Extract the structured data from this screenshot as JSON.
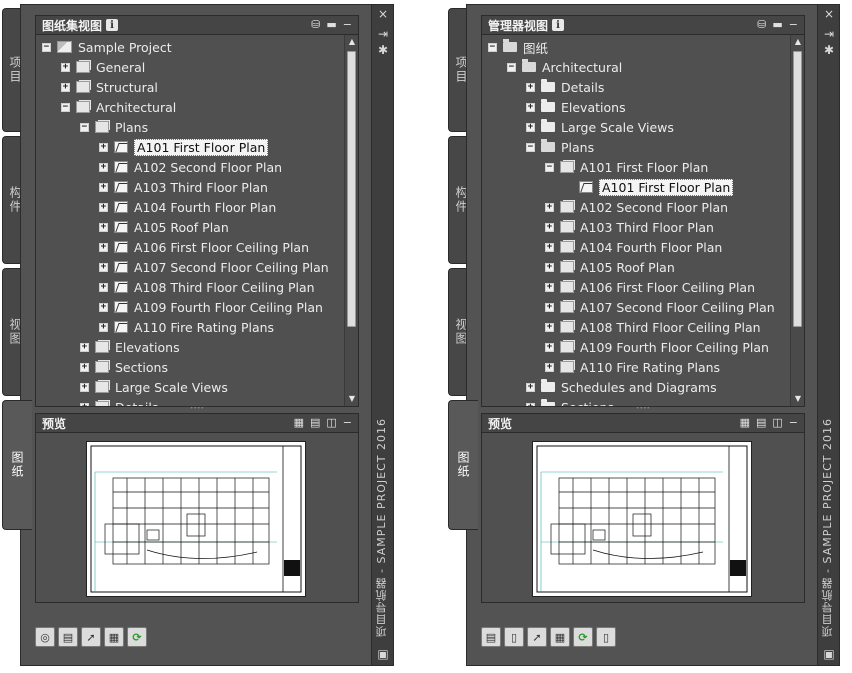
{
  "common": {
    "side_tabs": [
      "项目",
      "构件",
      "视图",
      "图纸"
    ],
    "preview_title": "预览",
    "vertical_title": "项目导航器 - SAMPLE PROJECT 2016",
    "dock_close": "×",
    "dock_pin": "⇥",
    "dock_settings": "✱"
  },
  "left": {
    "title": "图纸集视图",
    "info_glyph": "i",
    "tree": [
      {
        "depth": 0,
        "exp": "−",
        "icon": "proj",
        "label": "Sample Project"
      },
      {
        "depth": 1,
        "exp": "+",
        "icon": "subset",
        "label": "General"
      },
      {
        "depth": 1,
        "exp": "+",
        "icon": "subset",
        "label": "Structural"
      },
      {
        "depth": 1,
        "exp": "−",
        "icon": "subset",
        "label": "Architectural"
      },
      {
        "depth": 2,
        "exp": "−",
        "icon": "subset",
        "label": "Plans"
      },
      {
        "depth": 3,
        "exp": "+",
        "icon": "sheet",
        "label": "A101 First Floor Plan",
        "selected": true
      },
      {
        "depth": 3,
        "exp": "+",
        "icon": "sheet",
        "label": "A102 Second Floor Plan"
      },
      {
        "depth": 3,
        "exp": "+",
        "icon": "sheet",
        "label": "A103 Third Floor Plan"
      },
      {
        "depth": 3,
        "exp": "+",
        "icon": "sheet",
        "label": "A104 Fourth Floor Plan"
      },
      {
        "depth": 3,
        "exp": "+",
        "icon": "sheet",
        "label": "A105 Roof Plan"
      },
      {
        "depth": 3,
        "exp": "+",
        "icon": "sheet",
        "label": "A106 First Floor Ceiling Plan"
      },
      {
        "depth": 3,
        "exp": "+",
        "icon": "sheet",
        "label": "A107 Second Floor Ceiling Plan"
      },
      {
        "depth": 3,
        "exp": "+",
        "icon": "sheet",
        "label": "A108 Third Floor Ceiling Plan"
      },
      {
        "depth": 3,
        "exp": "+",
        "icon": "sheet",
        "label": "A109 Fourth Floor Ceiling Plan"
      },
      {
        "depth": 3,
        "exp": "+",
        "icon": "sheet",
        "label": "A110 Fire Rating Plans"
      },
      {
        "depth": 2,
        "exp": "+",
        "icon": "subset",
        "label": "Elevations"
      },
      {
        "depth": 2,
        "exp": "+",
        "icon": "subset",
        "label": "Sections"
      },
      {
        "depth": 2,
        "exp": "+",
        "icon": "subset",
        "label": "Large Scale Views"
      },
      {
        "depth": 2,
        "exp": "+",
        "icon": "subset",
        "label": "Details"
      }
    ],
    "toolbar": [
      "sheet-set-icon",
      "new-sheet-icon",
      "publish-icon",
      "properties-icon",
      "refresh-icon"
    ]
  },
  "right": {
    "title": "管理器视图",
    "info_glyph": "i",
    "tree": [
      {
        "depth": 0,
        "exp": "−",
        "icon": "folderopen",
        "label": "图纸"
      },
      {
        "depth": 1,
        "exp": "−",
        "icon": "folderopen",
        "label": "Architectural"
      },
      {
        "depth": 2,
        "exp": "+",
        "icon": "folder",
        "label": "Details"
      },
      {
        "depth": 2,
        "exp": "+",
        "icon": "folder",
        "label": "Elevations"
      },
      {
        "depth": 2,
        "exp": "+",
        "icon": "folder",
        "label": "Large Scale Views"
      },
      {
        "depth": 2,
        "exp": "−",
        "icon": "folderopen",
        "label": "Plans"
      },
      {
        "depth": 3,
        "exp": "−",
        "icon": "subset",
        "label": "A101 First Floor Plan"
      },
      {
        "depth": 4,
        "exp": "",
        "icon": "sheet",
        "label": "A101 First Floor Plan",
        "selected": true
      },
      {
        "depth": 3,
        "exp": "+",
        "icon": "subset",
        "label": "A102 Second Floor Plan"
      },
      {
        "depth": 3,
        "exp": "+",
        "icon": "subset",
        "label": "A103 Third Floor Plan"
      },
      {
        "depth": 3,
        "exp": "+",
        "icon": "subset",
        "label": "A104 Fourth Floor Plan"
      },
      {
        "depth": 3,
        "exp": "+",
        "icon": "subset",
        "label": "A105 Roof Plan"
      },
      {
        "depth": 3,
        "exp": "+",
        "icon": "subset",
        "label": "A106 First Floor Ceiling Plan"
      },
      {
        "depth": 3,
        "exp": "+",
        "icon": "subset",
        "label": "A107 Second Floor Ceiling Plan"
      },
      {
        "depth": 3,
        "exp": "+",
        "icon": "subset",
        "label": "A108 Third Floor Ceiling Plan"
      },
      {
        "depth": 3,
        "exp": "+",
        "icon": "subset",
        "label": "A109 Fourth Floor Ceiling Plan"
      },
      {
        "depth": 3,
        "exp": "+",
        "icon": "subset",
        "label": "A110 Fire Rating Plans"
      },
      {
        "depth": 2,
        "exp": "+",
        "icon": "folder",
        "label": "Schedules and Diagrams"
      },
      {
        "depth": 2,
        "exp": "+",
        "icon": "folder",
        "label": "Sections"
      }
    ],
    "toolbar": [
      "new-sheet-icon",
      "new-folder-icon",
      "publish-icon",
      "properties-icon",
      "refresh-icon",
      "disabled-icon"
    ]
  },
  "colors": {
    "panel_bg": "#535353",
    "header_bg": "#454545",
    "selection_bg": "#f4f4f4",
    "refresh_green": "#2a9a2a"
  }
}
